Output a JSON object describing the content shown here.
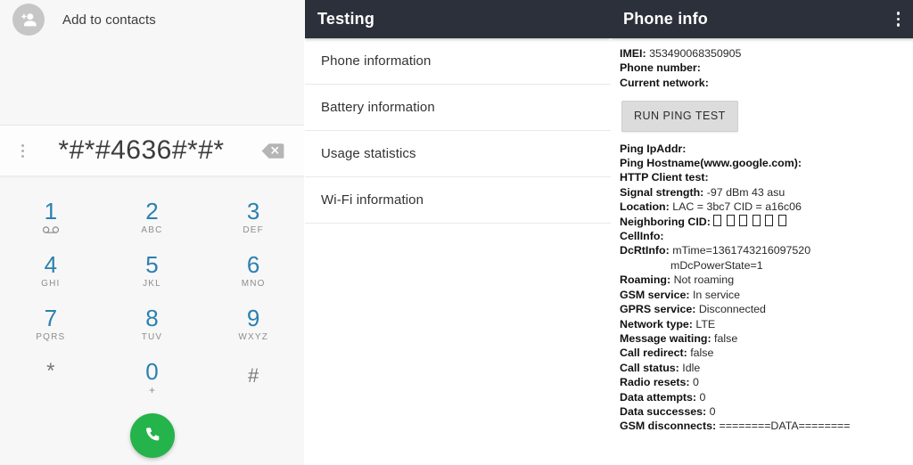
{
  "dialer": {
    "add_contacts_label": "Add to contacts",
    "add_contacts_icon": "person-add-icon",
    "overflow_icon": "overflow-menu-icon",
    "dialed_number": "*#*#4636#*#*",
    "backspace_icon": "backspace-icon",
    "call_icon": "phone-call-icon",
    "keys": [
      {
        "digit": "1",
        "sub": "⌀⌀",
        "sub_kind": "voicemail"
      },
      {
        "digit": "2",
        "sub": "ABC",
        "sub_kind": "letters"
      },
      {
        "digit": "3",
        "sub": "DEF",
        "sub_kind": "letters"
      },
      {
        "digit": "4",
        "sub": "GHI",
        "sub_kind": "letters"
      },
      {
        "digit": "5",
        "sub": "JKL",
        "sub_kind": "letters"
      },
      {
        "digit": "6",
        "sub": "MNO",
        "sub_kind": "letters"
      },
      {
        "digit": "7",
        "sub": "PQRS",
        "sub_kind": "letters"
      },
      {
        "digit": "8",
        "sub": "TUV",
        "sub_kind": "letters"
      },
      {
        "digit": "9",
        "sub": "WXYZ",
        "sub_kind": "letters"
      },
      {
        "digit": "*",
        "sub": "",
        "sub_kind": "none"
      },
      {
        "digit": "0",
        "sub": "+",
        "sub_kind": "plus"
      },
      {
        "digit": "#",
        "sub": "",
        "sub_kind": "none"
      }
    ]
  },
  "testing": {
    "title": "Testing",
    "items": [
      {
        "label": "Phone information"
      },
      {
        "label": "Battery information"
      },
      {
        "label": "Usage statistics"
      },
      {
        "label": "Wi-Fi information"
      }
    ]
  },
  "phone_info": {
    "title": "Phone info",
    "overflow_icon": "overflow-menu-icon",
    "ping_button_label": "RUN PING TEST",
    "fields": [
      {
        "label": "IMEI:",
        "value": "353490068350905"
      },
      {
        "label": "Phone number:",
        "value": ""
      },
      {
        "label": "Current network:",
        "value": ""
      },
      {
        "label": "Ping IpAddr:",
        "value": ""
      },
      {
        "label": "Ping Hostname(www.google.com):",
        "value": ""
      },
      {
        "label": "HTTP Client test:",
        "value": ""
      },
      {
        "label": "Signal strength:",
        "value": "-97 dBm   43 asu"
      },
      {
        "label": "Location:",
        "value": "LAC = 3bc7   CID = a16c06"
      },
      {
        "label": "Neighboring CID:",
        "value": "□ □ □ □ □ □",
        "value_kind": "tofu",
        "tofu_count": 6
      },
      {
        "label": "CellInfo:",
        "value": ""
      },
      {
        "label": "DcRtInfo:",
        "value": "mTime=1361743216097520",
        "continuation": "mDcPowerState=1"
      },
      {
        "label": "Roaming:",
        "value": "Not roaming"
      },
      {
        "label": "GSM service:",
        "value": "In service"
      },
      {
        "label": "GPRS service:",
        "value": "Disconnected"
      },
      {
        "label": "Network type:",
        "value": "LTE"
      },
      {
        "label": "Message waiting:",
        "value": "false"
      },
      {
        "label": "Call redirect:",
        "value": "false"
      },
      {
        "label": "Call status:",
        "value": "Idle"
      },
      {
        "label": "Radio resets:",
        "value": "0"
      },
      {
        "label": "Data attempts:",
        "value": "0"
      },
      {
        "label": "Data successes:",
        "value": "0"
      },
      {
        "label": "GSM disconnects:",
        "value": "========DATA========"
      }
    ]
  },
  "colors": {
    "appbar": "#2b303a",
    "keypad_digit": "#2b80af",
    "call_button": "#25b34b",
    "dialer_bg": "#f7f7f7",
    "ping_button": "#dcdcdc"
  }
}
